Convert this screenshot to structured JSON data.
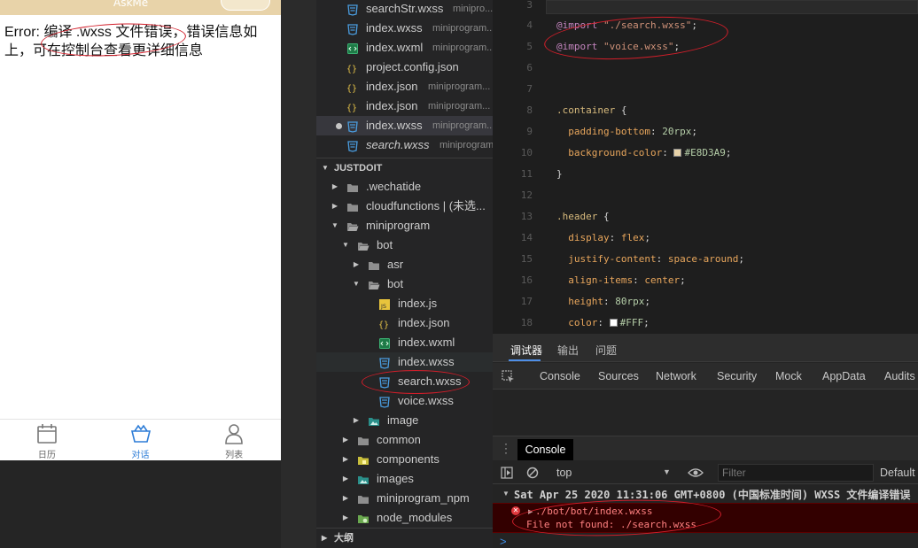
{
  "simulator": {
    "nav_title": "AskMe",
    "error_text": "Error: 编译 .wxss 文件错误，错误信息如上，可在控制台查看更详细信息",
    "tabs": [
      {
        "label": "日历",
        "icon": "calendar-icon",
        "active": false
      },
      {
        "label": "对话",
        "icon": "chat-basket-icon",
        "active": true
      },
      {
        "label": "列表",
        "icon": "person-icon",
        "active": false
      }
    ]
  },
  "explorer": {
    "open_editors": [
      {
        "name": "searchStr.wxss",
        "path": "minipro...",
        "icon": "css-file-icon"
      },
      {
        "name": "index.wxss",
        "path": "miniprogram...",
        "icon": "css-file-icon"
      },
      {
        "name": "index.wxml",
        "path": "miniprogram...",
        "icon": "wxml-file-icon"
      },
      {
        "name": "project.config.json",
        "path": "",
        "icon": "json-file-icon"
      },
      {
        "name": "index.json",
        "path": "miniprogram...",
        "icon": "json-file-icon"
      },
      {
        "name": "index.json",
        "path": "miniprogram...",
        "icon": "json-file-icon"
      },
      {
        "name": "index.wxss",
        "path": "miniprogram...",
        "icon": "css-file-icon",
        "modified": true
      },
      {
        "name": "search.wxss",
        "path": "miniprogram...",
        "icon": "css-file-icon",
        "italic": true
      }
    ],
    "project_title": "JUSTDOIT",
    "tree": [
      {
        "name": ".wechatide",
        "icon": "folder-icon"
      },
      {
        "name": "cloudfunctions | (未选...",
        "icon": "folder-icon"
      },
      {
        "name": "miniprogram",
        "icon": "folder-open-icon"
      },
      {
        "name": "bot",
        "icon": "folder-open-icon"
      },
      {
        "name": "asr",
        "icon": "folder-icon"
      },
      {
        "name": "bot",
        "icon": "folder-open-icon"
      },
      {
        "name": "index.js",
        "icon": "js-file-icon"
      },
      {
        "name": "index.json",
        "icon": "json-file-icon"
      },
      {
        "name": "index.wxml",
        "icon": "wxml-file-icon"
      },
      {
        "name": "index.wxss",
        "icon": "css-file-icon"
      },
      {
        "name": "search.wxss",
        "icon": "css-file-icon"
      },
      {
        "name": "voice.wxss",
        "icon": "css-file-icon"
      },
      {
        "name": "image",
        "icon": "image-folder-icon"
      },
      {
        "name": "common",
        "icon": "folder-icon"
      },
      {
        "name": "components",
        "icon": "components-folder-icon"
      },
      {
        "name": "images",
        "icon": "image-folder-icon"
      },
      {
        "name": "miniprogram_npm",
        "icon": "folder-icon"
      },
      {
        "name": "node_modules",
        "icon": "node-folder-icon"
      }
    ],
    "outline_title": "大纲"
  },
  "editor": {
    "lines": [
      {
        "n": "4",
        "parts": [
          {
            "t": "@import",
            "c": "k-at"
          },
          {
            "t": " "
          },
          {
            "t": "\"./search.wxss\"",
            "c": "k-str"
          },
          {
            "t": ";"
          }
        ]
      },
      {
        "n": "5",
        "parts": [
          {
            "t": "@import",
            "c": "k-at"
          },
          {
            "t": " "
          },
          {
            "t": "\"voice.wxss\"",
            "c": "k-str"
          },
          {
            "t": ";"
          }
        ]
      },
      {
        "n": "6",
        "parts": []
      },
      {
        "n": "7",
        "parts": []
      },
      {
        "n": "8",
        "parts": [
          {
            "t": ".container",
            "c": "k-sel"
          },
          {
            "t": " {"
          }
        ]
      },
      {
        "n": "9",
        "parts": [
          {
            "t": "  "
          },
          {
            "t": "padding-bottom",
            "c": "k-prop"
          },
          {
            "t": ": "
          },
          {
            "t": "20",
            "c": "k-num"
          },
          {
            "t": "rpx",
            "c": "k-num"
          },
          {
            "t": ";"
          }
        ]
      },
      {
        "n": "10",
        "parts": [
          {
            "t": "  "
          },
          {
            "t": "background-color",
            "c": "k-prop"
          },
          {
            "t": ": "
          },
          {
            "swatch": "#E8D3A9"
          },
          {
            "t": "#E8D3A9",
            "c": "k-num"
          },
          {
            "t": ";"
          }
        ]
      },
      {
        "n": "11",
        "parts": [
          {
            "t": "}"
          }
        ]
      },
      {
        "n": "12",
        "parts": []
      },
      {
        "n": "13",
        "parts": [
          {
            "t": ".header",
            "c": "k-sel"
          },
          {
            "t": " {"
          }
        ]
      },
      {
        "n": "14",
        "parts": [
          {
            "t": "  "
          },
          {
            "t": "display",
            "c": "k-prop"
          },
          {
            "t": ": "
          },
          {
            "t": "flex",
            "c": "k-val"
          },
          {
            "t": ";"
          }
        ]
      },
      {
        "n": "15",
        "parts": [
          {
            "t": "  "
          },
          {
            "t": "justify-content",
            "c": "k-prop"
          },
          {
            "t": ": "
          },
          {
            "t": "space-around",
            "c": "k-val"
          },
          {
            "t": ";"
          }
        ]
      },
      {
        "n": "16",
        "parts": [
          {
            "t": "  "
          },
          {
            "t": "align-items",
            "c": "k-prop"
          },
          {
            "t": ": "
          },
          {
            "t": "center",
            "c": "k-val"
          },
          {
            "t": ";"
          }
        ]
      },
      {
        "n": "17",
        "parts": [
          {
            "t": "  "
          },
          {
            "t": "height",
            "c": "k-prop"
          },
          {
            "t": ": "
          },
          {
            "t": "80",
            "c": "k-num"
          },
          {
            "t": "rpx",
            "c": "k-num"
          },
          {
            "t": ";"
          }
        ]
      },
      {
        "n": "18",
        "parts": [
          {
            "t": "  "
          },
          {
            "t": "color",
            "c": "k-prop"
          },
          {
            "t": ": "
          },
          {
            "swatch": "#FFFFFF"
          },
          {
            "t": "#FFF",
            "c": "k-num"
          },
          {
            "t": ";"
          }
        ]
      }
    ]
  },
  "devtools": {
    "top_tabs": [
      "调试器",
      "输出",
      "问题"
    ],
    "panels": [
      "Console",
      "Sources",
      "Network",
      "Security",
      "Mock",
      "AppData",
      "Audits"
    ],
    "drawer_tab": "Console",
    "context": "top",
    "filter_placeholder": "Filter",
    "levels_label": "Default l",
    "log_group_text": "Sat Apr 25 2020 11:31:06 GMT+0800 (中国标准时间)  WXSS 文件编译错误",
    "error_line1": "./bot/bot/index.wxss",
    "error_line2": "File not found: ./search.wxss",
    "prompt": ">"
  },
  "colors": {
    "accent_blue": "#4E8EE6",
    "brand_beige": "#E8D3A9",
    "annotation_red": "#D21E2A",
    "error_bg": "#330000"
  }
}
